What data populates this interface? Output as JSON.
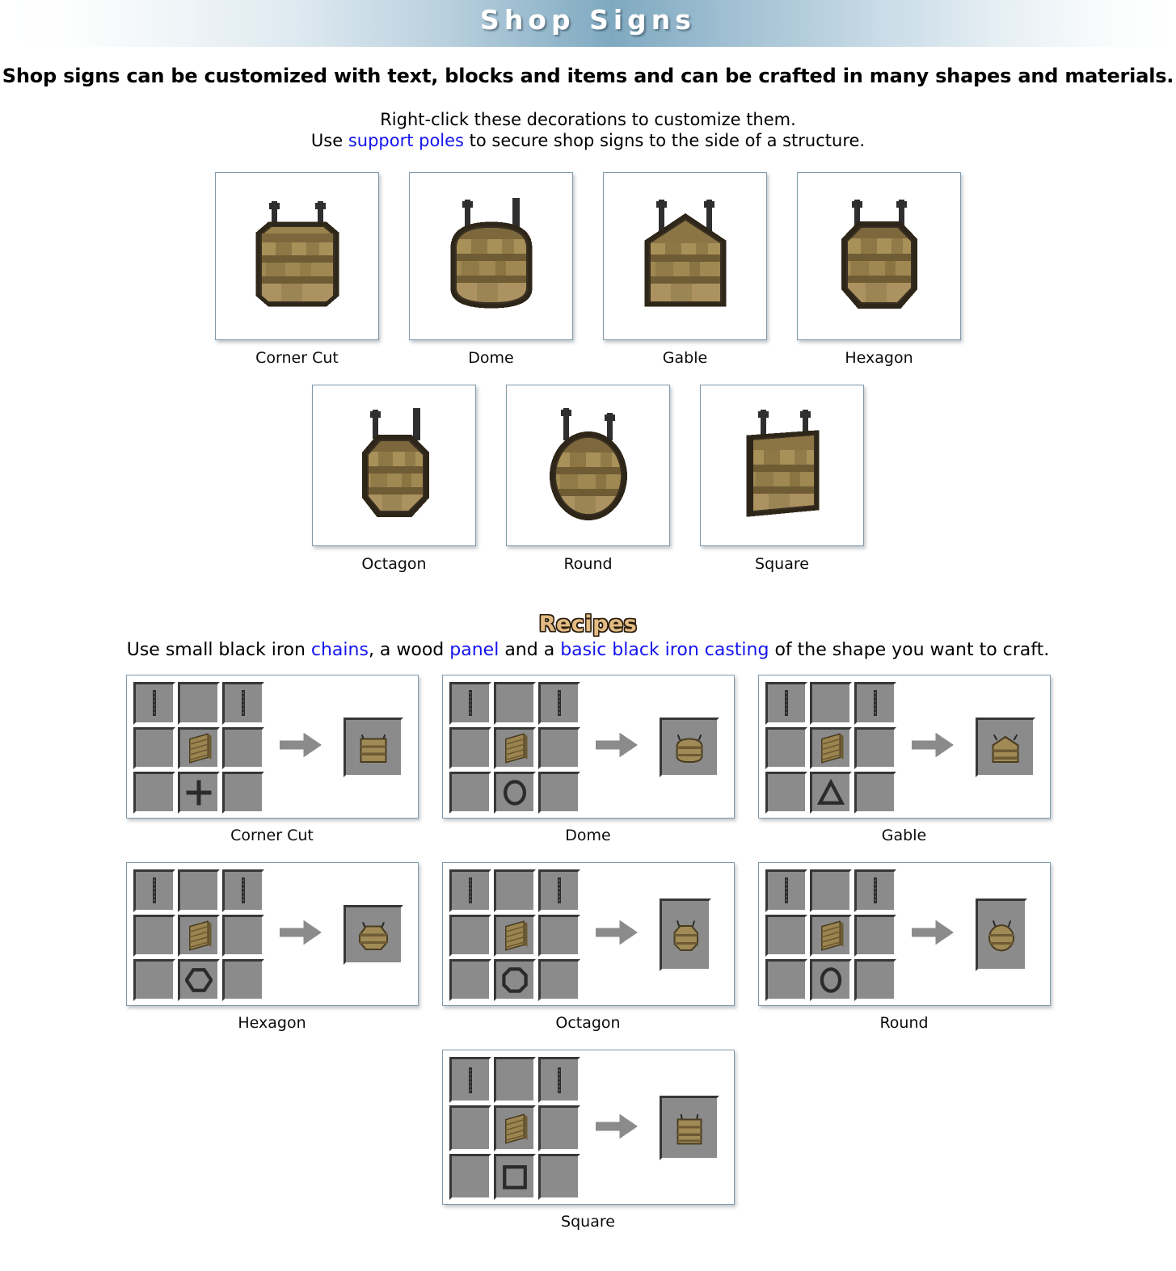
{
  "banner": {
    "title": "Shop Signs"
  },
  "intro": {
    "main": "Shop signs can be customized with text, blocks and items and can be crafted in many shapes and materials.",
    "line1": "Right-click these decorations to customize them.",
    "line2_pre": "Use ",
    "line2_link": "support poles",
    "line2_post": " to secure shop signs to the side of a structure."
  },
  "shapes": {
    "row1": [
      {
        "label": "Corner Cut",
        "icon": "shop-sign-corner-cut-icon"
      },
      {
        "label": "Dome",
        "icon": "shop-sign-dome-icon"
      },
      {
        "label": "Gable",
        "icon": "shop-sign-gable-icon"
      },
      {
        "label": "Hexagon",
        "icon": "shop-sign-hexagon-icon"
      }
    ],
    "row2": [
      {
        "label": "Octagon",
        "icon": "shop-sign-octagon-icon"
      },
      {
        "label": "Round",
        "icon": "shop-sign-round-icon"
      },
      {
        "label": "Square",
        "icon": "shop-sign-square-icon"
      }
    ]
  },
  "recipes": {
    "title": "Recipes",
    "sub_pre": "Use small black iron ",
    "sub_link1": "chains",
    "sub_mid1": ", a wood ",
    "sub_link2": "panel",
    "sub_mid2": " and a ",
    "sub_link3": "basic black iron casting",
    "sub_post": " of the shape you want to craft.",
    "ingredients": {
      "chain": "small-black-iron-chain-icon",
      "panel": "wood-panel-icon"
    },
    "row1": [
      {
        "label": "Corner Cut",
        "casting": "casting-cross-icon",
        "casting_shape": "cross",
        "result": "shop-sign-corner-cut-icon"
      },
      {
        "label": "Dome",
        "casting": "casting-oval-icon",
        "casting_shape": "oval",
        "result": "shop-sign-dome-icon"
      },
      {
        "label": "Gable",
        "casting": "casting-triangle-icon",
        "casting_shape": "triangle",
        "result": "shop-sign-gable-icon"
      }
    ],
    "row2": [
      {
        "label": "Hexagon",
        "casting": "casting-hexagon-icon",
        "casting_shape": "hexagon",
        "result": "shop-sign-hexagon-icon"
      },
      {
        "label": "Octagon",
        "casting": "casting-octagon-icon",
        "casting_shape": "octagon",
        "result": "shop-sign-octagon-icon"
      },
      {
        "label": "Round",
        "casting": "casting-circle-icon",
        "casting_shape": "circle",
        "result": "shop-sign-round-icon"
      }
    ],
    "row3": [
      {
        "label": "Square",
        "casting": "casting-square-icon",
        "casting_shape": "square",
        "result": "shop-sign-square-icon"
      }
    ]
  },
  "colors": {
    "link": "#1414ee",
    "recipes_title_fill": "#e3bb84",
    "recipes_title_outline": "#2a1d0c",
    "slot_gray": "#8b8b8b",
    "slot_dark_edge": "#373737",
    "slot_light_edge": "#ffffff",
    "card_border": "#8099ab",
    "wood_light": "#b39b68",
    "wood_mid": "#8e7744",
    "wood_dark": "#6b5a33",
    "iron_dark": "#2f2f2f"
  }
}
